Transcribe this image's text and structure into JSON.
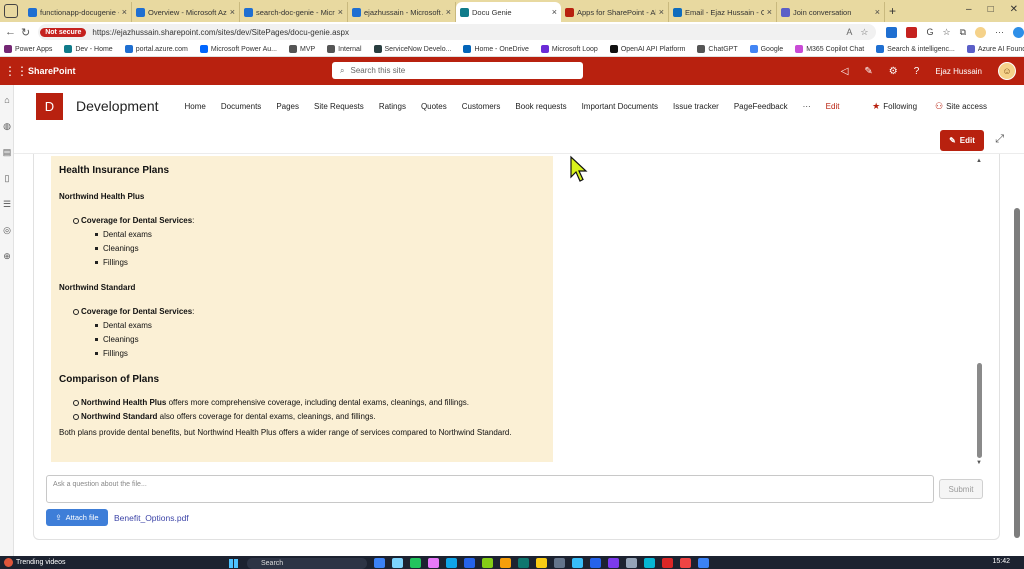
{
  "browser": {
    "tabs": [
      {
        "title": "functionapp-docugenie - Mi",
        "fav": "#1f6fd1",
        "active": false
      },
      {
        "title": "Overview - Microsoft Azure",
        "fav": "#1f6fd1",
        "active": false
      },
      {
        "title": "search-doc-genie - Micros",
        "fav": "#1f6fd1",
        "active": false
      },
      {
        "title": "ejazhussain - Microsoft Az",
        "fav": "#1f6fd1",
        "active": false
      },
      {
        "title": "Docu Genie",
        "fav": "#0f7b8a",
        "active": true
      },
      {
        "title": "Apps for SharePoint - All A",
        "fav": "#b8210f",
        "active": false
      },
      {
        "title": "Email - Ejaz Hussain - Outl",
        "fav": "#0f6cbd",
        "active": false
      },
      {
        "title": "Join conversation",
        "fav": "#5b5fc7",
        "active": false
      }
    ],
    "new_tab": "+",
    "window_controls": [
      "–",
      "□",
      "✕"
    ],
    "not_secure": "Not secure",
    "url": "https://ejazhussain.sharepoint.com/sites/dev/SitePages/docu-genie.aspx",
    "favorites": [
      {
        "label": "Power Apps",
        "color": "#742774"
      },
      {
        "label": "Dev - Home",
        "color": "#0f7b8a"
      },
      {
        "label": "portal.azure.com",
        "color": "#1f6fd1"
      },
      {
        "label": "Microsoft Power Au...",
        "color": "#0066ff"
      },
      {
        "label": "MVP",
        "color": "#555555"
      },
      {
        "label": "Internal",
        "color": "#555555"
      },
      {
        "label": "ServiceNow Develo...",
        "color": "#293e40"
      },
      {
        "label": "Home - OneDrive",
        "color": "#0364b8"
      },
      {
        "label": "Microsoft Loop",
        "color": "#6b2bd6"
      },
      {
        "label": "OpenAI API Platform",
        "color": "#111111"
      },
      {
        "label": "ChatGPT",
        "color": "#555555"
      },
      {
        "label": "Google",
        "color": "#4285f4"
      },
      {
        "label": "M365 Copilot Chat",
        "color": "#c94bd6"
      },
      {
        "label": "Search & intelligenc...",
        "color": "#1f6fd1"
      },
      {
        "label": "Azure AI Foundry",
        "color": "#5b5fc7"
      }
    ]
  },
  "suite": {
    "brand": "SharePoint",
    "search_placeholder": "Search this site",
    "user": "Ejaz Hussain",
    "accent": "#b8210f"
  },
  "site": {
    "logo_letter": "D",
    "title": "Development",
    "nav": [
      "Home",
      "Documents",
      "Pages",
      "Site Requests",
      "Ratings",
      "Quotes",
      "Customers",
      "Book requests",
      "Important Documents",
      "Issue tracker",
      "PageFeedback",
      "···"
    ],
    "nav_edit": "Edit",
    "following": "Following",
    "site_access": "Site access",
    "edit_button": "Edit"
  },
  "answer": {
    "heading": "Health Insurance Plans",
    "plans": [
      {
        "name": "Northwind Health Plus",
        "coverage_label": "Coverage for Dental Services",
        "services": [
          "Dental exams",
          "Cleanings",
          "Fillings"
        ]
      },
      {
        "name": "Northwind Standard",
        "coverage_label": "Coverage for Dental Services",
        "services": [
          "Dental exams",
          "Cleanings",
          "Fillings"
        ]
      }
    ],
    "comparison_heading": "Comparison of Plans",
    "comparison": [
      {
        "plan": "Northwind Health Plus",
        "text": " offers more comprehensive coverage, including dental exams, cleanings, and fillings."
      },
      {
        "plan": "Northwind Standard",
        "text": " also offers coverage for dental exams, cleanings, and fillings."
      }
    ],
    "summary": "Both plans provide dental benefits, but Northwind Health Plus offers a wider range of services compared to Northwind Standard."
  },
  "composer": {
    "placeholder": "Ask a question about the file...",
    "submit": "Submit",
    "attach": "Attach file",
    "file_name": "Benefit_Options.pdf"
  },
  "taskbar": {
    "weather": "Trending videos",
    "search": "Search",
    "clock": "15:42",
    "apps": [
      "#3b82f6",
      "#7dd3fc",
      "#22c55e",
      "#e879f9",
      "#0ea5e9",
      "#2563eb",
      "#84cc16",
      "#f59e0b",
      "#0f766e",
      "#facc15",
      "#64748b",
      "#38bdf8",
      "#2563eb",
      "#7c3aed",
      "#94a3b8",
      "#06b6d4",
      "#dc2626",
      "#ef4444",
      "#3b82f6"
    ]
  }
}
